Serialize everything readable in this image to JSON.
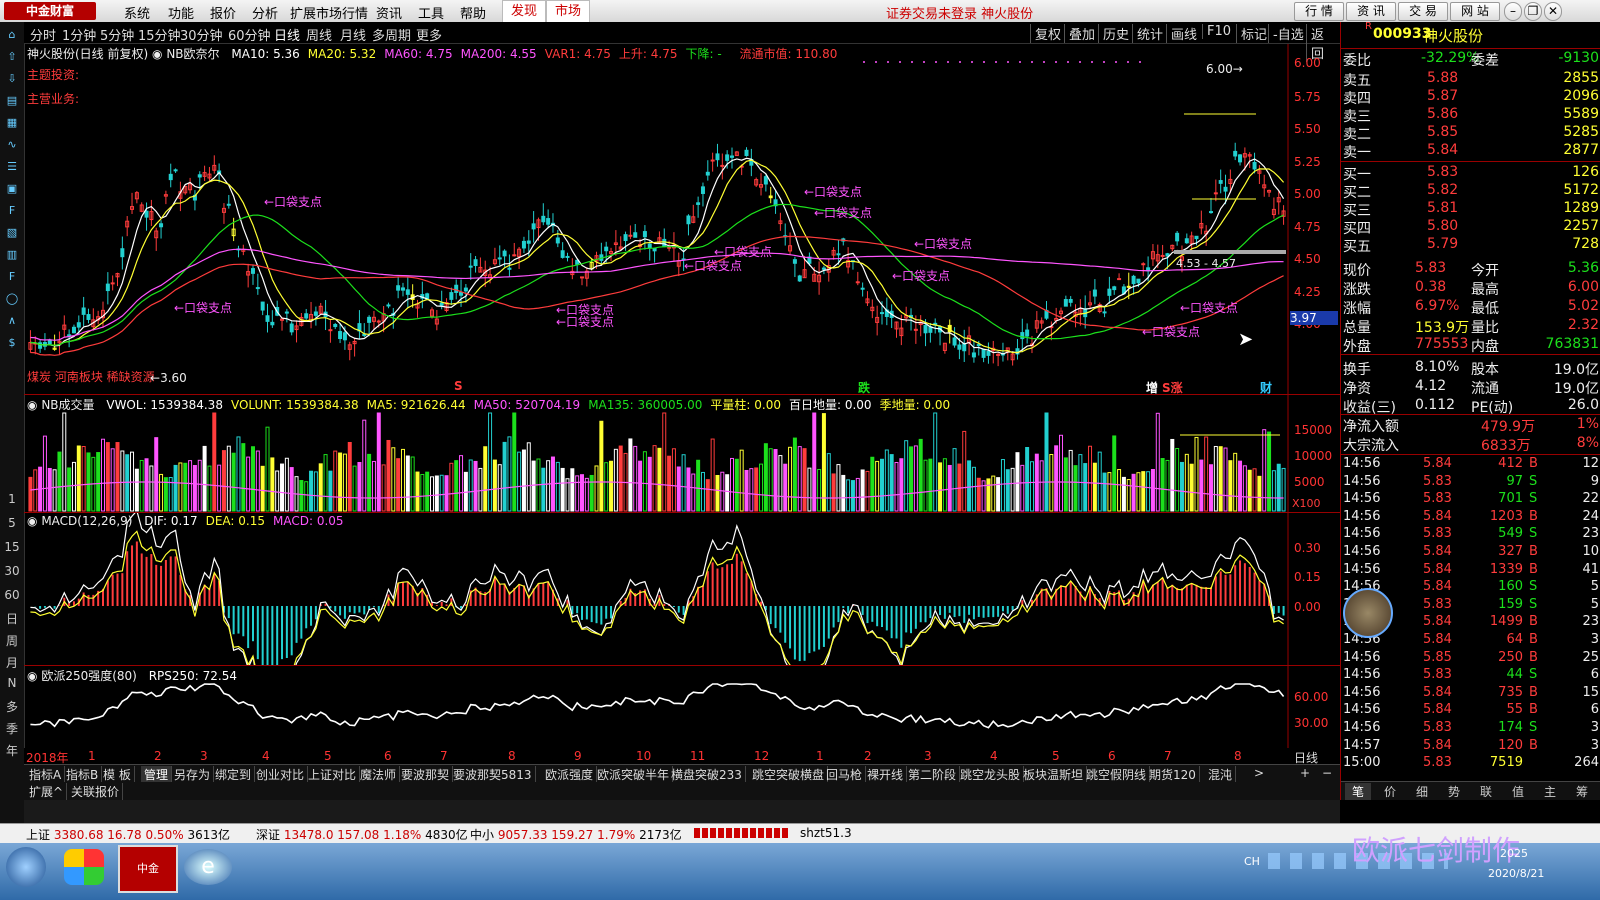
{
  "menu": {
    "logo": "中金财富",
    "items": [
      "系统",
      "功能",
      "报价",
      "分析",
      "扩展市场行情",
      "资讯",
      "工具",
      "帮助"
    ],
    "highlight": [
      "发现",
      "市场"
    ],
    "login_msg": "证券交易未登录  神火股份",
    "top_buttons": [
      "行 情",
      "资 讯",
      "交 易",
      "网 站"
    ]
  },
  "lefttoolbar": {
    "labels": [
      "1",
      "5",
      "15",
      "30",
      "60",
      "日",
      "周",
      "月",
      "N",
      "多",
      "季",
      "年"
    ],
    "icons": [
      "bar-chart-icon",
      "trend-icon",
      "list-icon",
      "grid-icon",
      "f10-icon",
      "fin-icon",
      "doc-icon",
      "f12-icon",
      "circle-icon",
      "rsi-icon",
      "coin-icon",
      "cross-icon",
      "pen-icon",
      "f5-icon",
      "tile-icon"
    ]
  },
  "periods": [
    "分时",
    "1分钟",
    "5分钟",
    "15分钟",
    "30分钟",
    "60分钟",
    "日线",
    "周线",
    "月线",
    "多周期",
    "更多"
  ],
  "period_active": "日线",
  "right_tabs": [
    "复权",
    "叠加",
    "历史",
    "统计",
    "画线",
    "F10",
    "标记",
    "-自选",
    "返回"
  ],
  "main_pane": {
    "title": "神火股份(日线 前复权)",
    "indicator": "NB欧奈尔",
    "ma": [
      {
        "label": "MA10: 5.36",
        "color": "#ffffff"
      },
      {
        "label": "MA20: 5.32",
        "color": "#ffff33"
      },
      {
        "label": "MA60: 4.75",
        "color": "#ff55ff"
      },
      {
        "label": "MA200: 4.55",
        "color": "#ff55ff"
      },
      {
        "label": "VAR1: 4.75",
        "color": "#ff3c3c"
      },
      {
        "label": "上升: 4.75",
        "color": "#ff3c3c"
      },
      {
        "label": "下降: -",
        "color": "#1ce01c"
      }
    ],
    "market_value": "流通市值: 110.80",
    "notes": [
      "主题投资:",
      "主营业务:"
    ],
    "concepts": "煤炭  河南板块  稀缺资源",
    "low_label": "3.60",
    "high_label": "6.00",
    "range_label": "4.53 - 4.57",
    "price_axis": [
      "6.00",
      "5.75",
      "5.50",
      "5.25",
      "5.00",
      "4.75",
      "4.50",
      "4.25",
      "4.00"
    ],
    "current_price_tag": "3.97",
    "support_label": "口袋支点",
    "markers": [
      {
        "t": "S",
        "c": "#ff3c3c"
      },
      {
        "t": "跌",
        "c": "#1ce01c"
      },
      {
        "t": "增",
        "c": "#ffffff"
      },
      {
        "t": "S涨",
        "c": "#ff3c3c"
      },
      {
        "t": "财",
        "c": "#33ccff"
      }
    ]
  },
  "volume_pane": {
    "title": "NB成交量",
    "items": [
      {
        "label": "VWOL: 1539384.38",
        "color": "#ffffff"
      },
      {
        "label": "VOLUNT: 1539384.38",
        "color": "#ffff33"
      },
      {
        "label": "MA5: 921626.44",
        "color": "#ffff33"
      },
      {
        "label": "MA50: 520704.19",
        "color": "#ff55ff"
      },
      {
        "label": "MA135: 360005.00",
        "color": "#1ce01c"
      },
      {
        "label": "平量柱: 0.00",
        "color": "#ffff33"
      },
      {
        "label": "百日地量: 0.00",
        "color": "#ffffff"
      },
      {
        "label": "季地量: 0.00",
        "color": "#ffff33"
      }
    ],
    "axis": [
      "15000",
      "10000",
      "5000"
    ],
    "unit": "X100"
  },
  "macd_pane": {
    "title": "MACD(12,26,9)",
    "items": [
      {
        "label": "DIF: 0.17",
        "color": "#ffffff"
      },
      {
        "label": "DEA: 0.15",
        "color": "#ffff33"
      },
      {
        "label": "MACD: 0.05",
        "color": "#ff55ff"
      }
    ],
    "axis": [
      "0.30",
      "0.15",
      "0.00"
    ]
  },
  "rps_pane": {
    "title": "欧派250强度(80)",
    "items": [
      {
        "label": "RPS250: 72.54",
        "color": "#ffffff"
      }
    ],
    "axis": [
      "60.00",
      "30.00"
    ]
  },
  "time_axis": {
    "labels": [
      "2018年",
      "1",
      "2",
      "3",
      "4",
      "5",
      "6",
      "7",
      "8",
      "9",
      "10",
      "11",
      "12",
      "1",
      "2",
      "3",
      "4",
      "5",
      "6",
      "7",
      "8"
    ],
    "period": "日线"
  },
  "bottom_tabs": [
    "指标A",
    "指标B",
    "模 板",
    "管理",
    "另存为",
    "绑定到",
    "创业对比",
    "上证对比",
    "魔法师",
    "要波那契",
    "要波那契5813",
    "欧派强度",
    "欧派突破半年",
    "横盘突破233",
    "跳空突破横盘",
    "回马枪",
    "裸开线",
    "第二阶段",
    "跳空龙头股",
    "板块温斯坦",
    "跳空假阴线",
    "期货120",
    "混沌"
  ],
  "bottom_tabs2": [
    "扩展^",
    "关联报价"
  ],
  "quote": {
    "code": "000933",
    "name": "神火股份",
    "webi": "-32.29%",
    "weicha": "-9130",
    "asks": [
      {
        "l": "卖五",
        "p": "5.88",
        "v": "2855"
      },
      {
        "l": "卖四",
        "p": "5.87",
        "v": "2096"
      },
      {
        "l": "卖三",
        "p": "5.86",
        "v": "5589"
      },
      {
        "l": "卖二",
        "p": "5.85",
        "v": "5285"
      },
      {
        "l": "卖一",
        "p": "5.84",
        "v": "2877"
      }
    ],
    "bids": [
      {
        "l": "买一",
        "p": "5.83",
        "v": "126"
      },
      {
        "l": "买二",
        "p": "5.82",
        "v": "5172"
      },
      {
        "l": "买三",
        "p": "5.81",
        "v": "1289"
      },
      {
        "l": "买四",
        "p": "5.80",
        "v": "2257"
      },
      {
        "l": "买五",
        "p": "5.79",
        "v": "728"
      }
    ],
    "stats": [
      {
        "a": "现价",
        "av": "5.83",
        "b": "今开",
        "bv": "5.36"
      },
      {
        "a": "涨跌",
        "av": "0.38",
        "b": "最高",
        "bv": "6.00"
      },
      {
        "a": "涨幅",
        "av": "6.97%",
        "b": "最低",
        "bv": "5.02"
      },
      {
        "a": "总量",
        "av": "153.9万",
        "b": "量比",
        "bv": "2.32"
      },
      {
        "a": "外盘",
        "av": "775553",
        "b": "内盘",
        "bv": "763831"
      },
      {
        "a": "换手",
        "av": "8.10%",
        "b": "股本",
        "bv": "19.0亿"
      },
      {
        "a": "净资",
        "av": "4.12",
        "b": "流通",
        "bv": "19.0亿"
      },
      {
        "a": "收益(三)",
        "av": "0.112",
        "b": "PE(动)",
        "bv": "26.0"
      }
    ],
    "flows": [
      {
        "l": "净流入额",
        "v": "479.9万",
        "p": "1%"
      },
      {
        "l": "大宗流入",
        "v": "6833万",
        "p": "8%"
      }
    ],
    "ticks": [
      {
        "t": "14:56",
        "p": "5.84",
        "v": "412",
        "s": "B",
        "n": "12"
      },
      {
        "t": "14:56",
        "p": "5.83",
        "v": "97",
        "s": "S",
        "n": "9"
      },
      {
        "t": "14:56",
        "p": "5.83",
        "v": "701",
        "s": "S",
        "n": "22"
      },
      {
        "t": "14:56",
        "p": "5.84",
        "v": "1203",
        "s": "B",
        "n": "24"
      },
      {
        "t": "14:56",
        "p": "5.83",
        "v": "549",
        "s": "S",
        "n": "23"
      },
      {
        "t": "14:56",
        "p": "5.84",
        "v": "327",
        "s": "B",
        "n": "10"
      },
      {
        "t": "14:56",
        "p": "5.84",
        "v": "1339",
        "s": "B",
        "n": "41"
      },
      {
        "t": "14:56",
        "p": "5.84",
        "v": "160",
        "s": "S",
        "n": "5"
      },
      {
        "t": "14:56",
        "p": "5.83",
        "v": "159",
        "s": "S",
        "n": "5"
      },
      {
        "t": "14:56",
        "p": "5.84",
        "v": "1499",
        "s": "B",
        "n": "23"
      },
      {
        "t": "14:56",
        "p": "5.84",
        "v": "64",
        "s": "B",
        "n": "3"
      },
      {
        "t": "14:56",
        "p": "5.85",
        "v": "250",
        "s": "B",
        "n": "25"
      },
      {
        "t": "14:56",
        "p": "5.83",
        "v": "44",
        "s": "S",
        "n": "6"
      },
      {
        "t": "14:56",
        "p": "5.84",
        "v": "735",
        "s": "B",
        "n": "15"
      },
      {
        "t": "14:56",
        "p": "5.84",
        "v": "55",
        "s": "B",
        "n": "6"
      },
      {
        "t": "14:56",
        "p": "5.83",
        "v": "174",
        "s": "S",
        "n": "3"
      },
      {
        "t": "14:57",
        "p": "5.84",
        "v": "120",
        "s": "B",
        "n": "3"
      },
      {
        "t": "15:00",
        "p": "5.83",
        "v": "7519",
        "s": "",
        "n": "264"
      }
    ],
    "tabs": [
      "笔",
      "价",
      "细",
      "势",
      "联",
      "值",
      "主",
      "筹"
    ]
  },
  "statusbar": {
    "sh": {
      "name": "上证",
      "val": "3380.68",
      "chg": "16.78",
      "pct": "0.50%",
      "amt": "3613亿"
    },
    "sz": {
      "name": "深证",
      "val": "13478.0",
      "chg": "157.08",
      "pct": "1.18%",
      "amt": "4830亿"
    },
    "zx": {
      "name": "中小",
      "val": "9057.33",
      "chg": "159.27",
      "pct": "1.79%",
      "amt": "2173亿"
    },
    "server": "shzt51.3"
  },
  "taskbar": {
    "watermark": "欧派七剑制作",
    "time": "2020/8/21",
    "year": "2025",
    "ime": "CH"
  }
}
